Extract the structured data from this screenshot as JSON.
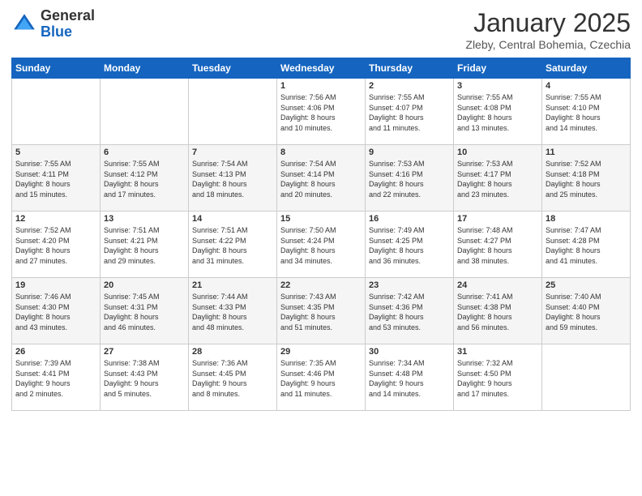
{
  "header": {
    "logo_general": "General",
    "logo_blue": "Blue",
    "month_title": "January 2025",
    "location": "Zleby, Central Bohemia, Czechia"
  },
  "days_of_week": [
    "Sunday",
    "Monday",
    "Tuesday",
    "Wednesday",
    "Thursday",
    "Friday",
    "Saturday"
  ],
  "weeks": [
    [
      {
        "day": "",
        "info": ""
      },
      {
        "day": "",
        "info": ""
      },
      {
        "day": "",
        "info": ""
      },
      {
        "day": "1",
        "info": "Sunrise: 7:56 AM\nSunset: 4:06 PM\nDaylight: 8 hours\nand 10 minutes."
      },
      {
        "day": "2",
        "info": "Sunrise: 7:55 AM\nSunset: 4:07 PM\nDaylight: 8 hours\nand 11 minutes."
      },
      {
        "day": "3",
        "info": "Sunrise: 7:55 AM\nSunset: 4:08 PM\nDaylight: 8 hours\nand 13 minutes."
      },
      {
        "day": "4",
        "info": "Sunrise: 7:55 AM\nSunset: 4:10 PM\nDaylight: 8 hours\nand 14 minutes."
      }
    ],
    [
      {
        "day": "5",
        "info": "Sunrise: 7:55 AM\nSunset: 4:11 PM\nDaylight: 8 hours\nand 15 minutes."
      },
      {
        "day": "6",
        "info": "Sunrise: 7:55 AM\nSunset: 4:12 PM\nDaylight: 8 hours\nand 17 minutes."
      },
      {
        "day": "7",
        "info": "Sunrise: 7:54 AM\nSunset: 4:13 PM\nDaylight: 8 hours\nand 18 minutes."
      },
      {
        "day": "8",
        "info": "Sunrise: 7:54 AM\nSunset: 4:14 PM\nDaylight: 8 hours\nand 20 minutes."
      },
      {
        "day": "9",
        "info": "Sunrise: 7:53 AM\nSunset: 4:16 PM\nDaylight: 8 hours\nand 22 minutes."
      },
      {
        "day": "10",
        "info": "Sunrise: 7:53 AM\nSunset: 4:17 PM\nDaylight: 8 hours\nand 23 minutes."
      },
      {
        "day": "11",
        "info": "Sunrise: 7:52 AM\nSunset: 4:18 PM\nDaylight: 8 hours\nand 25 minutes."
      }
    ],
    [
      {
        "day": "12",
        "info": "Sunrise: 7:52 AM\nSunset: 4:20 PM\nDaylight: 8 hours\nand 27 minutes."
      },
      {
        "day": "13",
        "info": "Sunrise: 7:51 AM\nSunset: 4:21 PM\nDaylight: 8 hours\nand 29 minutes."
      },
      {
        "day": "14",
        "info": "Sunrise: 7:51 AM\nSunset: 4:22 PM\nDaylight: 8 hours\nand 31 minutes."
      },
      {
        "day": "15",
        "info": "Sunrise: 7:50 AM\nSunset: 4:24 PM\nDaylight: 8 hours\nand 34 minutes."
      },
      {
        "day": "16",
        "info": "Sunrise: 7:49 AM\nSunset: 4:25 PM\nDaylight: 8 hours\nand 36 minutes."
      },
      {
        "day": "17",
        "info": "Sunrise: 7:48 AM\nSunset: 4:27 PM\nDaylight: 8 hours\nand 38 minutes."
      },
      {
        "day": "18",
        "info": "Sunrise: 7:47 AM\nSunset: 4:28 PM\nDaylight: 8 hours\nand 41 minutes."
      }
    ],
    [
      {
        "day": "19",
        "info": "Sunrise: 7:46 AM\nSunset: 4:30 PM\nDaylight: 8 hours\nand 43 minutes."
      },
      {
        "day": "20",
        "info": "Sunrise: 7:45 AM\nSunset: 4:31 PM\nDaylight: 8 hours\nand 46 minutes."
      },
      {
        "day": "21",
        "info": "Sunrise: 7:44 AM\nSunset: 4:33 PM\nDaylight: 8 hours\nand 48 minutes."
      },
      {
        "day": "22",
        "info": "Sunrise: 7:43 AM\nSunset: 4:35 PM\nDaylight: 8 hours\nand 51 minutes."
      },
      {
        "day": "23",
        "info": "Sunrise: 7:42 AM\nSunset: 4:36 PM\nDaylight: 8 hours\nand 53 minutes."
      },
      {
        "day": "24",
        "info": "Sunrise: 7:41 AM\nSunset: 4:38 PM\nDaylight: 8 hours\nand 56 minutes."
      },
      {
        "day": "25",
        "info": "Sunrise: 7:40 AM\nSunset: 4:40 PM\nDaylight: 8 hours\nand 59 minutes."
      }
    ],
    [
      {
        "day": "26",
        "info": "Sunrise: 7:39 AM\nSunset: 4:41 PM\nDaylight: 9 hours\nand 2 minutes."
      },
      {
        "day": "27",
        "info": "Sunrise: 7:38 AM\nSunset: 4:43 PM\nDaylight: 9 hours\nand 5 minutes."
      },
      {
        "day": "28",
        "info": "Sunrise: 7:36 AM\nSunset: 4:45 PM\nDaylight: 9 hours\nand 8 minutes."
      },
      {
        "day": "29",
        "info": "Sunrise: 7:35 AM\nSunset: 4:46 PM\nDaylight: 9 hours\nand 11 minutes."
      },
      {
        "day": "30",
        "info": "Sunrise: 7:34 AM\nSunset: 4:48 PM\nDaylight: 9 hours\nand 14 minutes."
      },
      {
        "day": "31",
        "info": "Sunrise: 7:32 AM\nSunset: 4:50 PM\nDaylight: 9 hours\nand 17 minutes."
      },
      {
        "day": "",
        "info": ""
      }
    ]
  ]
}
